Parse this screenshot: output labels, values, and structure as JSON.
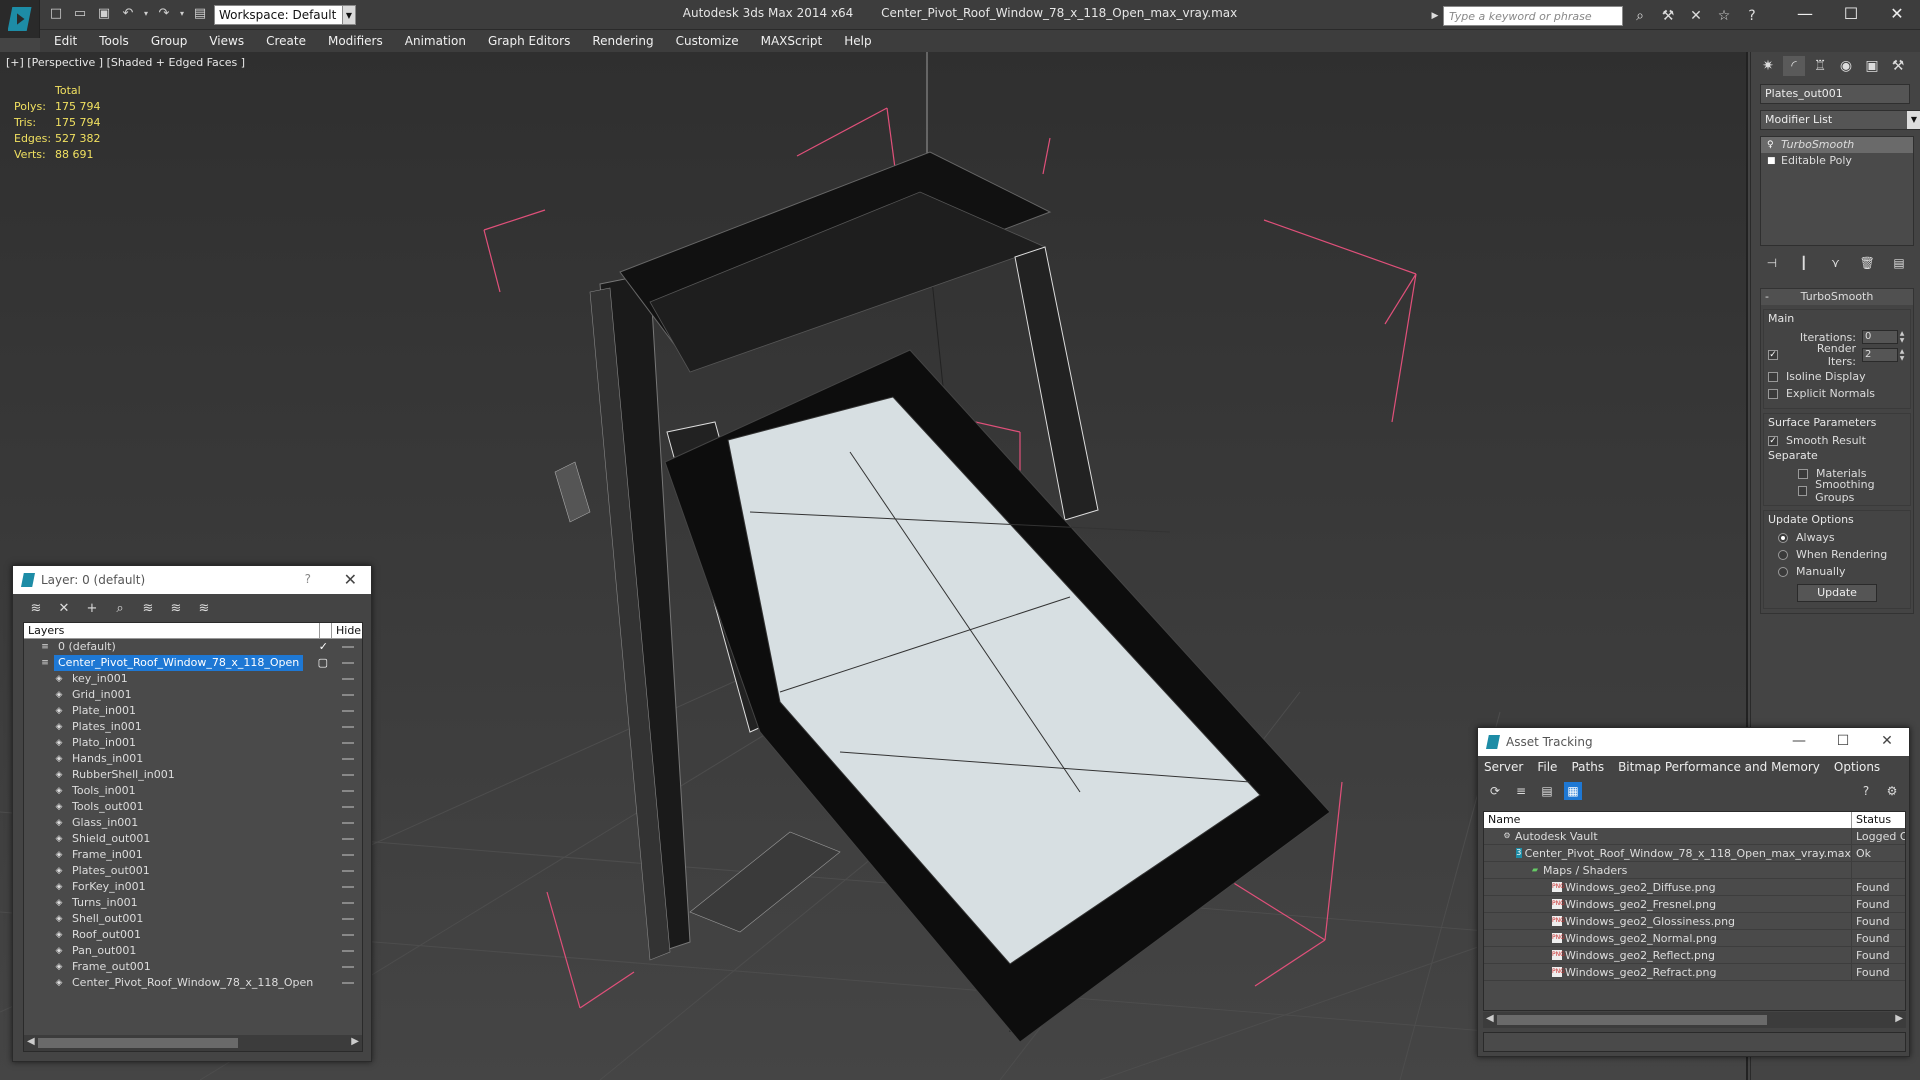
{
  "titlebar": {
    "app_title": "Autodesk 3ds Max  2014 x64",
    "file_name": "Center_Pivot_Roof_Window_78_x_118_Open_max_vray.max",
    "workspace": "Workspace: Default",
    "search_placeholder": "Type a keyword or phrase"
  },
  "menu": [
    "Edit",
    "Tools",
    "Group",
    "Views",
    "Create",
    "Modifiers",
    "Animation",
    "Graph Editors",
    "Rendering",
    "Customize",
    "MAXScript",
    "Help"
  ],
  "viewport": {
    "label": "[+] [Perspective ] [Shaded + Edged Faces ]",
    "stats_header": "Total",
    "stats": [
      {
        "k": "Polys:",
        "v": "175 794"
      },
      {
        "k": "Tris:",
        "v": "175 794"
      },
      {
        "k": "Edges:",
        "v": "527 382"
      },
      {
        "k": "Verts:",
        "v": "88 691"
      }
    ]
  },
  "command_panel": {
    "object_name": "Plates_out001",
    "modifier_list": "Modifier List",
    "stack": [
      "TurboSmooth",
      "Editable Poly"
    ],
    "rollout_title": "TurboSmooth",
    "main_group": "Main",
    "iterations_label": "Iterations:",
    "iterations_value": "0",
    "render_iters_label": "Render Iters:",
    "render_iters_value": "2",
    "isoline": "Isoline Display",
    "explicit_normals": "Explicit Normals",
    "surface_params": "Surface Parameters",
    "smooth_result": "Smooth Result",
    "separate": "Separate",
    "materials": "Materials",
    "smoothing_groups": "Smoothing Groups",
    "update_options": "Update Options",
    "always": "Always",
    "when_rendering": "When Rendering",
    "manually": "Manually",
    "update_button": "Update"
  },
  "layer_dialog": {
    "title": "Layer: 0 (default)",
    "help": "?",
    "col_layers": "Layers",
    "col_hide": "Hide",
    "layers": [
      "0 (default)",
      "Center_Pivot_Roof_Window_78_x_118_Open",
      "key_in001",
      "Grid_in001",
      "Plate_in001",
      "Plates_in001",
      "Plato_in001",
      "Hands_in001",
      "RubberShell_in001",
      "Tools_in001",
      "Tools_out001",
      "Glass_in001",
      "Shield_out001",
      "Frame_in001",
      "Plates_out001",
      "ForKey_in001",
      "Turns_in001",
      "Shell_out001",
      "Roof_out001",
      "Pan_out001",
      "Frame_out001",
      "Center_Pivot_Roof_Window_78_x_118_Open"
    ]
  },
  "asset_dialog": {
    "title": "Asset Tracking",
    "menu": [
      "Server",
      "File",
      "Paths",
      "Bitmap Performance and Memory",
      "Options"
    ],
    "col_name": "Name",
    "col_status": "Status",
    "rows": [
      {
        "name": "Autodesk Vault",
        "status": "Logged Ou"
      },
      {
        "name": "Center_Pivot_Roof_Window_78_x_118_Open_max_vray.max",
        "status": "Ok"
      },
      {
        "name": "Maps / Shaders",
        "status": ""
      },
      {
        "name": "Windows_geo2_Diffuse.png",
        "status": "Found"
      },
      {
        "name": "Windows_geo2_Fresnel.png",
        "status": "Found"
      },
      {
        "name": "Windows_geo2_Glossiness.png",
        "status": "Found"
      },
      {
        "name": "Windows_geo2_Normal.png",
        "status": "Found"
      },
      {
        "name": "Windows_geo2_Reflect.png",
        "status": "Found"
      },
      {
        "name": "Windows_geo2_Refract.png",
        "status": "Found"
      }
    ]
  },
  "colors": {
    "selection": "#1e78d4",
    "stats_text": "#f0e060",
    "bbox": "#e0507a",
    "brand": "#1d8ca6"
  }
}
